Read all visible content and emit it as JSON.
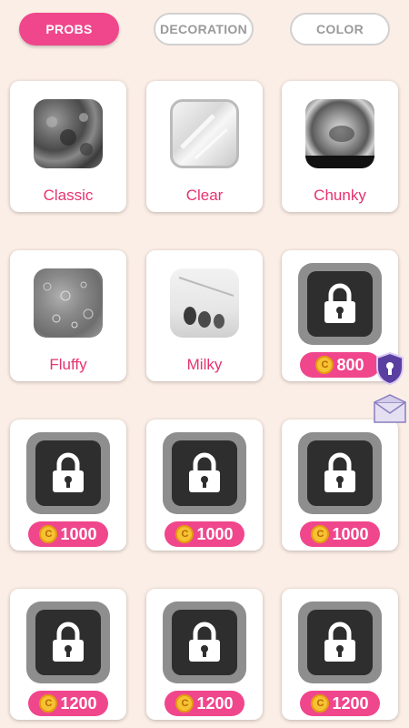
{
  "tabs": [
    {
      "label": "PROBS",
      "active": true
    },
    {
      "label": "DECORATION",
      "active": false
    },
    {
      "label": "COLOR",
      "active": false
    }
  ],
  "items": [
    {
      "name": "Classic",
      "locked": false
    },
    {
      "name": "Clear",
      "locked": false
    },
    {
      "name": "Chunky",
      "locked": false
    },
    {
      "name": "Fluffy",
      "locked": false
    },
    {
      "name": "Milky",
      "locked": false
    },
    {
      "locked": true,
      "price": "800"
    },
    {
      "locked": true,
      "price": "1000"
    },
    {
      "locked": true,
      "price": "1000"
    },
    {
      "locked": true,
      "price": "1000"
    },
    {
      "locked": true,
      "price": "1200"
    },
    {
      "locked": true,
      "price": "1200"
    },
    {
      "locked": true,
      "price": "1200"
    }
  ],
  "coin_symbol": "C",
  "colors": {
    "accent": "#f0468c",
    "label": "#e6336f",
    "background": "#fbeee6"
  },
  "side_icons": [
    "shield-lock-icon",
    "envelope-icon"
  ]
}
